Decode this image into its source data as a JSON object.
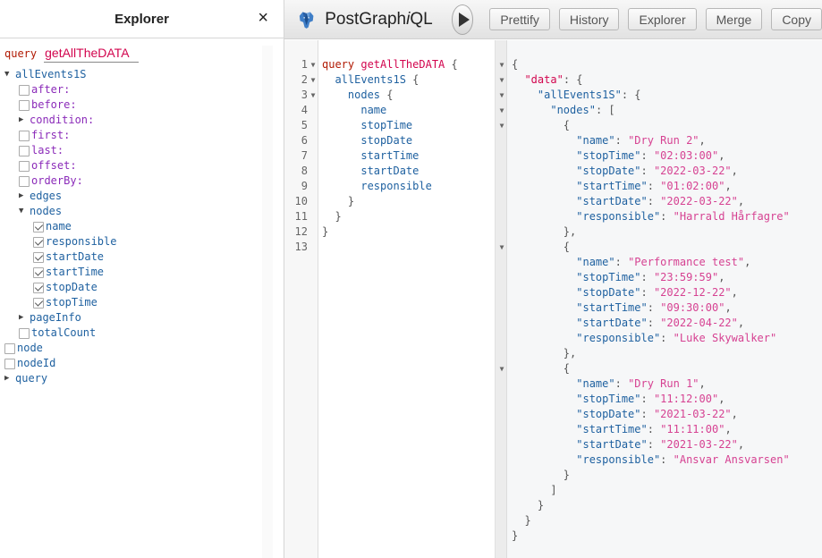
{
  "explorer": {
    "title": "Explorer",
    "close_icon": "×",
    "operation": {
      "keyword": "query",
      "name": "getAllTheDATA"
    },
    "tree": [
      {
        "label": "allEvents1S",
        "indent": 0,
        "kind": "expanded",
        "type": "field"
      },
      {
        "label": "after:",
        "indent": 1,
        "kind": "checkbox",
        "checked": false,
        "type": "arg"
      },
      {
        "label": "before:",
        "indent": 1,
        "kind": "checkbox",
        "checked": false,
        "type": "arg"
      },
      {
        "label": "condition:",
        "indent": 1,
        "kind": "collapsed",
        "type": "arg"
      },
      {
        "label": "first:",
        "indent": 1,
        "kind": "checkbox",
        "checked": false,
        "type": "arg"
      },
      {
        "label": "last:",
        "indent": 1,
        "kind": "checkbox",
        "checked": false,
        "type": "arg"
      },
      {
        "label": "offset:",
        "indent": 1,
        "kind": "checkbox",
        "checked": false,
        "type": "arg"
      },
      {
        "label": "orderBy:",
        "indent": 1,
        "kind": "checkbox",
        "checked": false,
        "type": "arg"
      },
      {
        "label": "edges",
        "indent": 1,
        "kind": "collapsed",
        "type": "field"
      },
      {
        "label": "nodes",
        "indent": 1,
        "kind": "expanded",
        "type": "field"
      },
      {
        "label": "name",
        "indent": 2,
        "kind": "checkbox",
        "checked": true,
        "type": "field"
      },
      {
        "label": "responsible",
        "indent": 2,
        "kind": "checkbox",
        "checked": true,
        "type": "field"
      },
      {
        "label": "startDate",
        "indent": 2,
        "kind": "checkbox",
        "checked": true,
        "type": "field"
      },
      {
        "label": "startTime",
        "indent": 2,
        "kind": "checkbox",
        "checked": true,
        "type": "field"
      },
      {
        "label": "stopDate",
        "indent": 2,
        "kind": "checkbox",
        "checked": true,
        "type": "field"
      },
      {
        "label": "stopTime",
        "indent": 2,
        "kind": "checkbox",
        "checked": true,
        "type": "field"
      },
      {
        "label": "pageInfo",
        "indent": 1,
        "kind": "collapsed",
        "type": "field"
      },
      {
        "label": "totalCount",
        "indent": 1,
        "kind": "checkbox",
        "checked": false,
        "type": "field"
      },
      {
        "label": "node",
        "indent": 0,
        "kind": "checkbox",
        "checked": false,
        "type": "field"
      },
      {
        "label": "nodeId",
        "indent": 0,
        "kind": "checkbox",
        "checked": false,
        "type": "field"
      },
      {
        "label": "query",
        "indent": 0,
        "kind": "collapsed",
        "type": "field"
      }
    ]
  },
  "toolbar": {
    "logo_icon": "postgres-elephant",
    "app_title_pre": "PostGraph",
    "app_title_i": "i",
    "app_title_post": "QL",
    "run_icon": "play",
    "buttons": [
      "Prettify",
      "History",
      "Explorer",
      "Merge",
      "Copy"
    ]
  },
  "query_editor": {
    "lines": [
      {
        "n": "1",
        "fold": true,
        "indent": 0,
        "parts": [
          [
            "kw",
            "query"
          ],
          [
            "pun",
            " "
          ],
          [
            "def",
            "getAllTheDATA"
          ],
          [
            "pun",
            " {"
          ]
        ]
      },
      {
        "n": "2",
        "fold": true,
        "indent": 1,
        "parts": [
          [
            "fld",
            "allEvents1S"
          ],
          [
            "pun",
            " {"
          ]
        ]
      },
      {
        "n": "3",
        "fold": true,
        "indent": 2,
        "parts": [
          [
            "fld",
            "nodes"
          ],
          [
            "pun",
            " {"
          ]
        ]
      },
      {
        "n": "4",
        "fold": false,
        "indent": 3,
        "parts": [
          [
            "fld",
            "name"
          ]
        ]
      },
      {
        "n": "5",
        "fold": false,
        "indent": 3,
        "parts": [
          [
            "fld",
            "stopTime"
          ]
        ]
      },
      {
        "n": "6",
        "fold": false,
        "indent": 3,
        "parts": [
          [
            "fld",
            "stopDate"
          ]
        ]
      },
      {
        "n": "7",
        "fold": false,
        "indent": 3,
        "parts": [
          [
            "fld",
            "startTime"
          ]
        ]
      },
      {
        "n": "8",
        "fold": false,
        "indent": 3,
        "parts": [
          [
            "fld",
            "startDate"
          ]
        ]
      },
      {
        "n": "9",
        "fold": false,
        "indent": 3,
        "parts": [
          [
            "fld",
            "responsible"
          ]
        ]
      },
      {
        "n": "10",
        "fold": false,
        "indent": 2,
        "parts": [
          [
            "pun",
            "}"
          ]
        ]
      },
      {
        "n": "11",
        "fold": false,
        "indent": 1,
        "parts": [
          [
            "pun",
            "}"
          ]
        ]
      },
      {
        "n": "12",
        "fold": false,
        "indent": 0,
        "parts": [
          [
            "pun",
            "}"
          ]
        ]
      },
      {
        "n": "13",
        "fold": false,
        "indent": 0,
        "parts": []
      }
    ]
  },
  "result": {
    "data": {
      "allEvents1S": {
        "nodes": [
          {
            "name": "Dry Run 2",
            "stopTime": "02:03:00",
            "stopDate": "2022-03-22",
            "startTime": "01:02:00",
            "startDate": "2022-03-22",
            "responsible": "Harrald Hårfagre"
          },
          {
            "name": "Performance test",
            "stopTime": "23:59:59",
            "stopDate": "2022-12-22",
            "startTime": "09:30:00",
            "startDate": "2022-04-22",
            "responsible": "Luke Skywalker"
          },
          {
            "name": "Dry Run 1",
            "stopTime": "11:12:00",
            "stopDate": "2021-03-22",
            "startTime": "11:11:00",
            "startDate": "2021-03-22",
            "responsible": "Ansvar Ansvarsen"
          }
        ]
      }
    }
  }
}
